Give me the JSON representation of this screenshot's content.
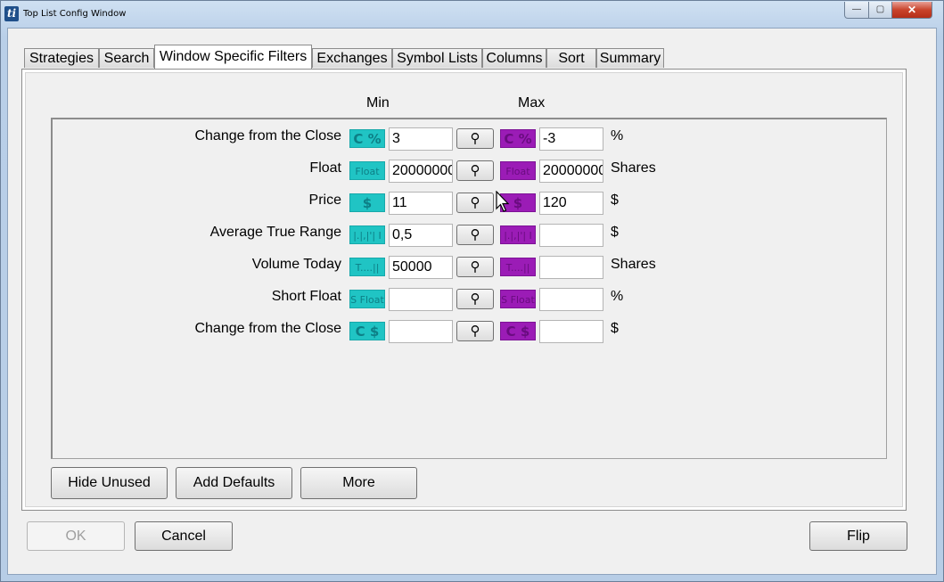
{
  "window": {
    "title": "Top List Config Window",
    "icon_text": "ti",
    "controls": {
      "minimize": "—",
      "maximize": "▢",
      "close": "✕"
    }
  },
  "tabs": [
    {
      "label": "Strategies"
    },
    {
      "label": "Search"
    },
    {
      "label": "Window Specific Filters",
      "active": true
    },
    {
      "label": "Exchanges"
    },
    {
      "label": "Symbol Lists"
    },
    {
      "label": "Columns"
    },
    {
      "label": "Sort"
    },
    {
      "label": "Summary"
    }
  ],
  "filters": {
    "min_header": "Min",
    "max_header": "Max",
    "search_icon": "⚲",
    "rows": [
      {
        "label": "Change from the Close",
        "icon_text": "C %",
        "min": "3",
        "max": "-3",
        "unit": "%"
      },
      {
        "label": "Float",
        "icon_text": "Float",
        "min": "20000000",
        "max": "20000000",
        "unit": "Shares"
      },
      {
        "label": "Price",
        "icon_text": "$",
        "min": "11",
        "max": "120",
        "unit": "$"
      },
      {
        "label": "Average True Range",
        "icon_text": "|.|,|'|  I",
        "min": "0,5",
        "max": "",
        "unit": "$"
      },
      {
        "label": "Volume Today",
        "icon_text": "T....||",
        "min": "50000",
        "max": "",
        "unit": "Shares"
      },
      {
        "label": "Short Float",
        "icon_text": "S Float",
        "min": "",
        "max": "",
        "unit": "%"
      },
      {
        "label": "Change from the Close",
        "icon_text": "C $",
        "min": "",
        "max": "",
        "unit": "$"
      }
    ]
  },
  "panel_buttons": {
    "hide_unused": "Hide Unused",
    "add_defaults": "Add Defaults",
    "more": "More"
  },
  "dialog_buttons": {
    "ok": "OK",
    "cancel": "Cancel",
    "flip": "Flip"
  },
  "colors": {
    "min_icon": "#20c4c4",
    "max_icon": "#9b1cb6"
  }
}
